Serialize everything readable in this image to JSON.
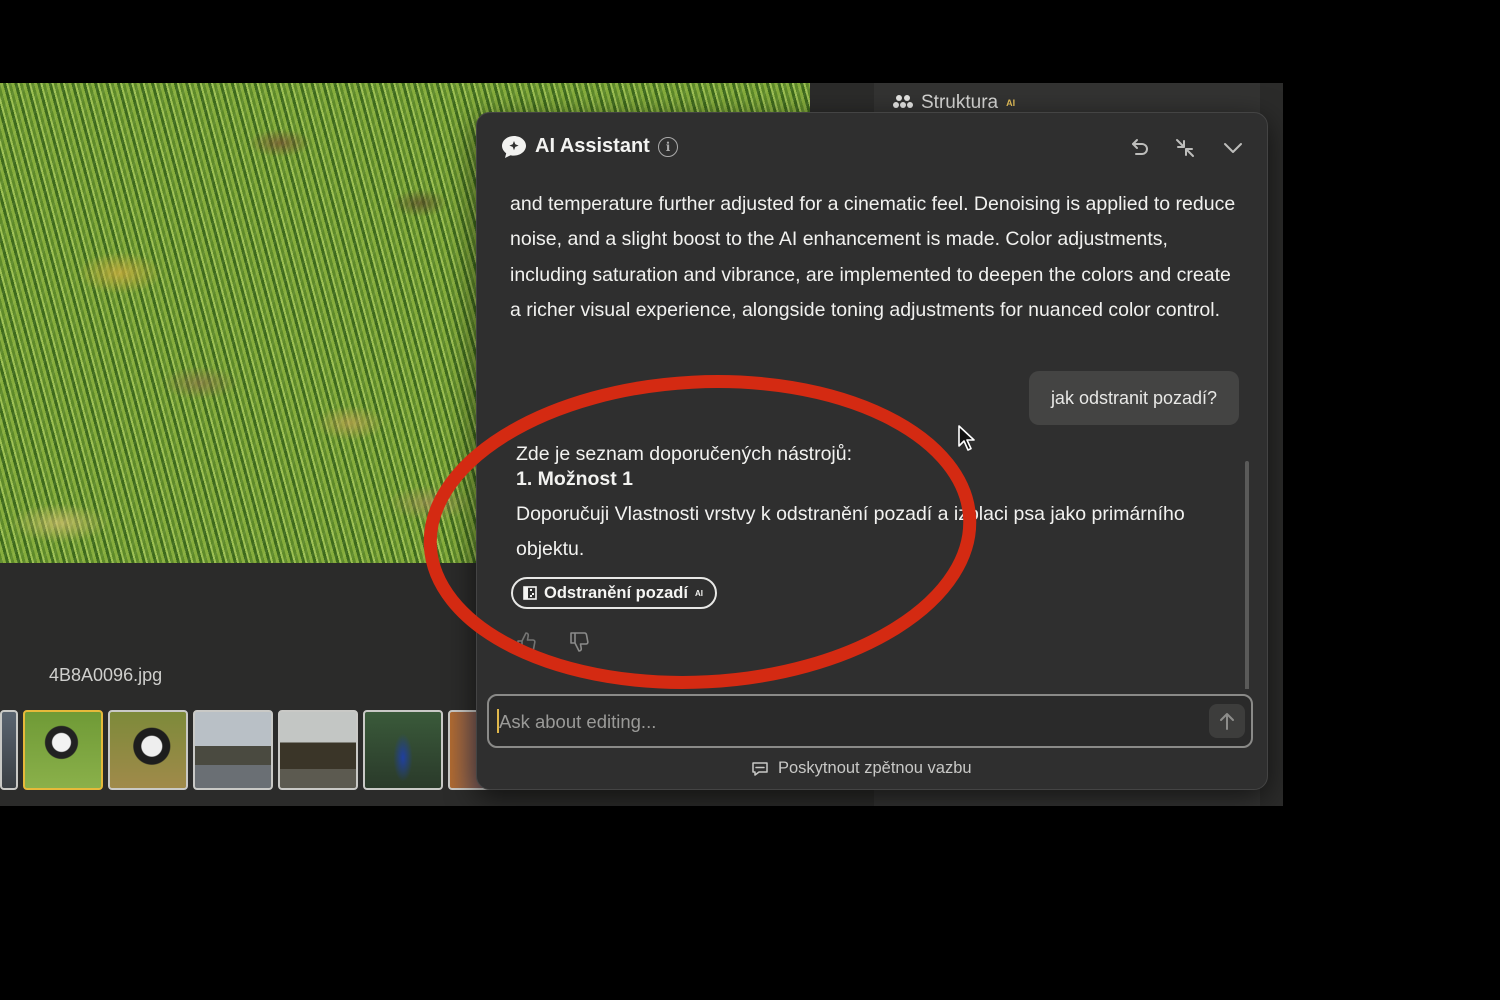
{
  "app": {
    "filename": "4B8A0096.jpg",
    "right_tab": {
      "label": "Struktura",
      "badge": "AI"
    },
    "filmstrip_count": 6
  },
  "assistant": {
    "title": "AI Assistant",
    "previous_message": "and temperature further adjusted for a cinematic feel. Denoising is applied to reduce noise, and a slight boost to the AI enhancement is made. Color adjustments, including saturation and vibrance, are implemented to deepen the colors and create a richer visual experience, alongside toning adjustments for nuanced color control.",
    "user_message": "jak odstranit pozadí?",
    "response": {
      "intro": "Zde je seznam doporučených nástrojů:",
      "option": "1. Možnost 1",
      "body": "Doporučuji Vlastnosti vrstvy k odstranění pozadí a izolaci psa jako primárního objektu.",
      "tool_chip": {
        "label": "Odstranění pozadí",
        "badge": "AI"
      }
    },
    "input": {
      "placeholder": "Ask about editing...",
      "value": ""
    },
    "feedback_label": "Poskytnout zpětnou vazbu"
  },
  "colors": {
    "panel_bg": "#2f2f2f",
    "accent_gold": "#e6b93a",
    "annotation_red": "#d42a12"
  },
  "icons": [
    "chat-bubble-icon",
    "info-icon",
    "undo-icon",
    "collapse-icon",
    "chevron-down-icon",
    "thumbs-up-icon",
    "thumbs-down-icon",
    "send-arrow-icon",
    "feedback-icon",
    "background-removal-icon",
    "structure-icon"
  ]
}
